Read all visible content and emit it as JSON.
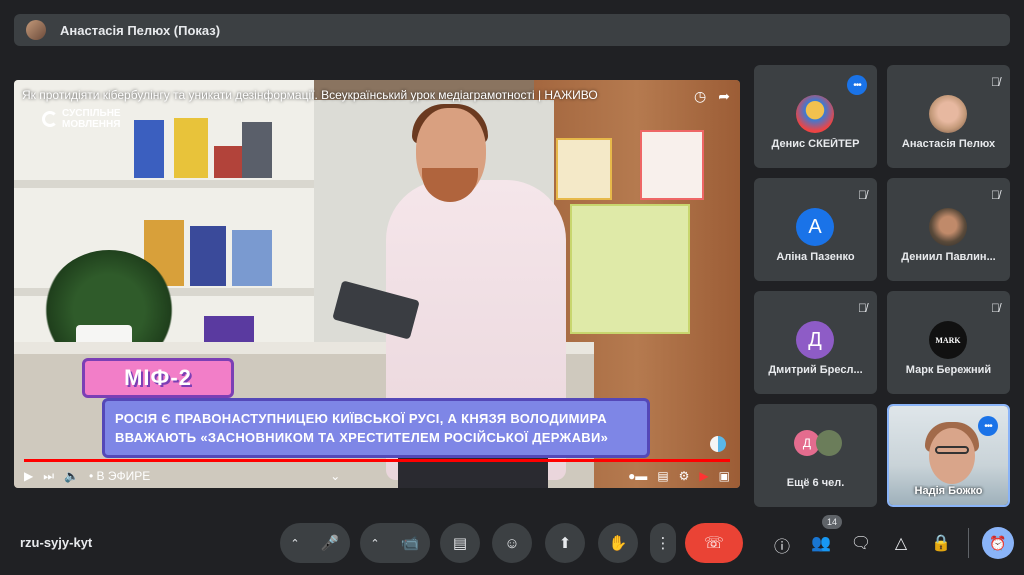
{
  "presenter": {
    "name": "Анастасія Пелюх (Показ)"
  },
  "video": {
    "title": "Як протидіяти кібербулінгу та уникати дезінформації. Всеукраїнський урок медіаграмотності | НАЖИВО",
    "channel_line1": "СУСПІЛЬНЕ",
    "channel_line2": "МОВЛЕННЯ",
    "myth_badge": "МІФ-2",
    "myth_caption": "Росія є правонаступницею Київської Русі, а князя Володимира вважають «засновником та хрестителем російської держави»",
    "live_label": "• В ЭФИРЕ",
    "progress": 1.0
  },
  "participants": [
    {
      "name": "Денис СКЕЙТЕР",
      "status": "speaking",
      "avatar": "image",
      "avatar_color": "#f2c14e"
    },
    {
      "name": "Анастасія Пелюх",
      "status": "muted",
      "avatar": "image",
      "avatar_color": "#c49a7a"
    },
    {
      "name": "Аліна Пазенко",
      "status": "muted",
      "avatar": "letter",
      "letter": "А",
      "avatar_color": "#1a73e8"
    },
    {
      "name": "Дениил Павлин...",
      "status": "muted",
      "avatar": "image",
      "avatar_color": "#5a4a3a"
    },
    {
      "name": "Дмитрий Бресл...",
      "status": "muted",
      "avatar": "letter",
      "letter": "Д",
      "avatar_color": "#8e5cc6"
    },
    {
      "name": "Марк Бережний",
      "status": "muted",
      "avatar": "text",
      "letter": "MARK",
      "avatar_color": "#111111"
    }
  ],
  "more_tile": {
    "label": "Ещё 6 чел.",
    "letter": "Д"
  },
  "self_tile": {
    "name": "Надія Божко",
    "status": "speaking"
  },
  "bottom": {
    "meeting_code": "rzu-syjy-kyt",
    "participants_count": "14"
  },
  "icons": {
    "clock": "clock-icon",
    "share": "share-icon",
    "mic_off": "mic-off-icon",
    "mic": "mic-icon",
    "camera": "camera-icon",
    "captions": "captions-icon",
    "emoji": "emoji-icon",
    "present": "present-icon",
    "hand": "hand-icon",
    "more": "more-vert-icon",
    "hangup": "hangup-icon",
    "info": "info-icon",
    "people": "people-icon",
    "chat": "chat-icon",
    "activities": "activities-icon",
    "host_controls": "lock-person-icon",
    "timer": "timer-icon"
  }
}
